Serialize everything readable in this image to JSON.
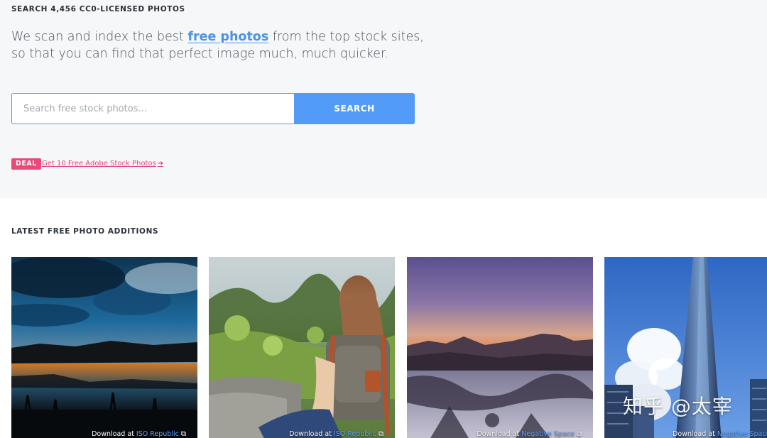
{
  "hero": {
    "kicker": "SEARCH 4,456 CC0-LICENSED PHOTOS",
    "lead_before": "We scan and index the best ",
    "lead_link": "free photos",
    "lead_after": " from the top stock sites, so that you can find that perfect image much, much quicker.",
    "search": {
      "placeholder": "Search free stock photos...",
      "button_label": "SEARCH"
    },
    "deal": {
      "badge": "DEAL",
      "link_text": "Get 10 Free Adobe Stock Photos",
      "link_icon": "arrow-right-icon"
    }
  },
  "latest": {
    "title": "LATEST FREE PHOTO ADDITIONS",
    "photos": [
      {
        "scene": "sunset over a lake with dramatic blue clouds",
        "credit_prefix": "Download at",
        "source": "ISO Republic",
        "icon": "external-link-icon"
      },
      {
        "scene": "woman with a backpack sitting in a meadow",
        "credit_prefix": "Download at",
        "source": "ISO Republic",
        "icon": "external-link-icon"
      },
      {
        "scene": "purple dusk over snowy mountains",
        "credit_prefix": "Download at",
        "source": "Negative Space",
        "icon": "external-link-icon"
      },
      {
        "scene": "glass skyscraper against blue sky",
        "credit_prefix": "Download at",
        "source": "Negative Space",
        "icon": "external-link-icon"
      }
    ]
  },
  "watermark": "知乎 @太宰",
  "colors": {
    "accent": "#529bf6",
    "link": "#4c93e2",
    "deal": "#ea4a7a",
    "hero_bg": "#f5f7f9"
  }
}
